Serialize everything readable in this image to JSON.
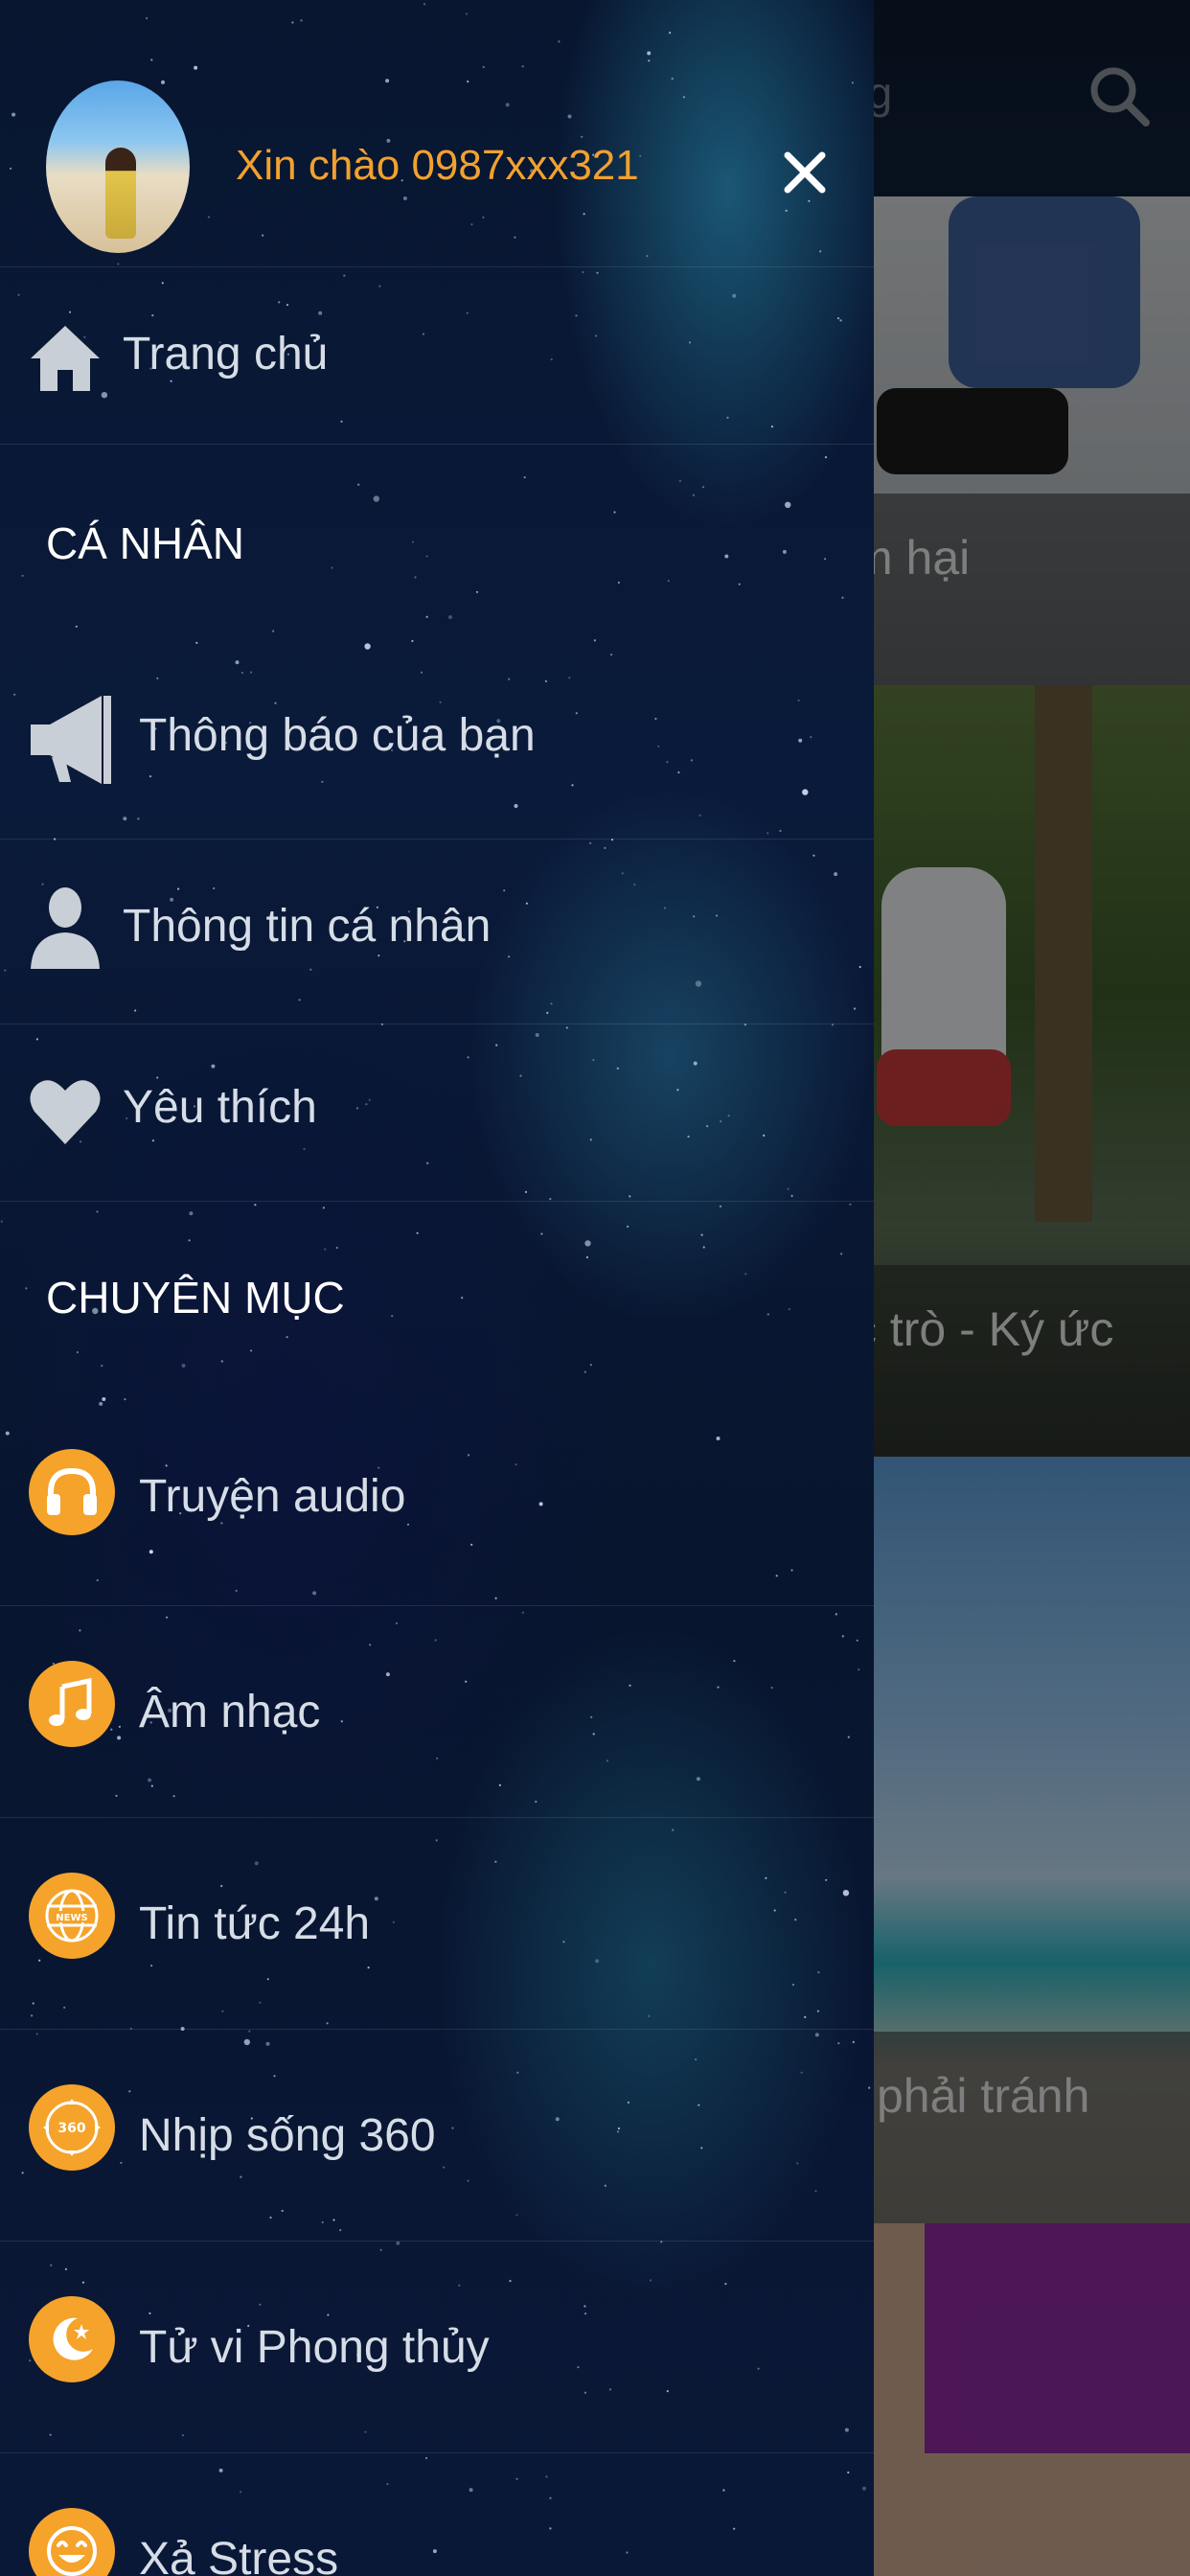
{
  "background_app": {
    "header_title_fragment": "ng",
    "cards": [
      {
        "caption": "m hại"
      },
      {
        "caption": "c trò - Ký ức"
      },
      {
        "caption": "i phải tránh"
      },
      {
        "caption": ""
      }
    ]
  },
  "drawer": {
    "greeting": "Xin chào 0987xxx321",
    "home": {
      "label": "Trang chủ",
      "icon": "home-icon"
    },
    "personal_section": {
      "title": "CÁ NHÂN",
      "items": [
        {
          "label": "Thông báo của bạn",
          "icon": "megaphone-icon"
        },
        {
          "label": "Thông tin cá nhân",
          "icon": "user-icon"
        },
        {
          "label": "Yêu thích",
          "icon": "heart-icon"
        }
      ]
    },
    "category_section": {
      "title": "CHUYÊN MỤC",
      "items": [
        {
          "label": "Truyện audio",
          "icon": "headphones-icon"
        },
        {
          "label": "Âm nhạc",
          "icon": "music-note-icon"
        },
        {
          "label": "Tin tức 24h",
          "icon": "news-globe-icon",
          "badge_text": "NEWS"
        },
        {
          "label": "Nhịp sống 360",
          "icon": "360-icon",
          "badge_text": "360"
        },
        {
          "label": "Tử vi Phong thủy",
          "icon": "moon-star-icon"
        },
        {
          "label": "Xả Stress",
          "icon": "smile-icon"
        }
      ]
    }
  },
  "colors": {
    "accent_orange": "#f5a32a",
    "greeting_orange": "#f2a12e",
    "drawer_bg": "#0a1a3a",
    "menu_text": "#d6dde6"
  }
}
